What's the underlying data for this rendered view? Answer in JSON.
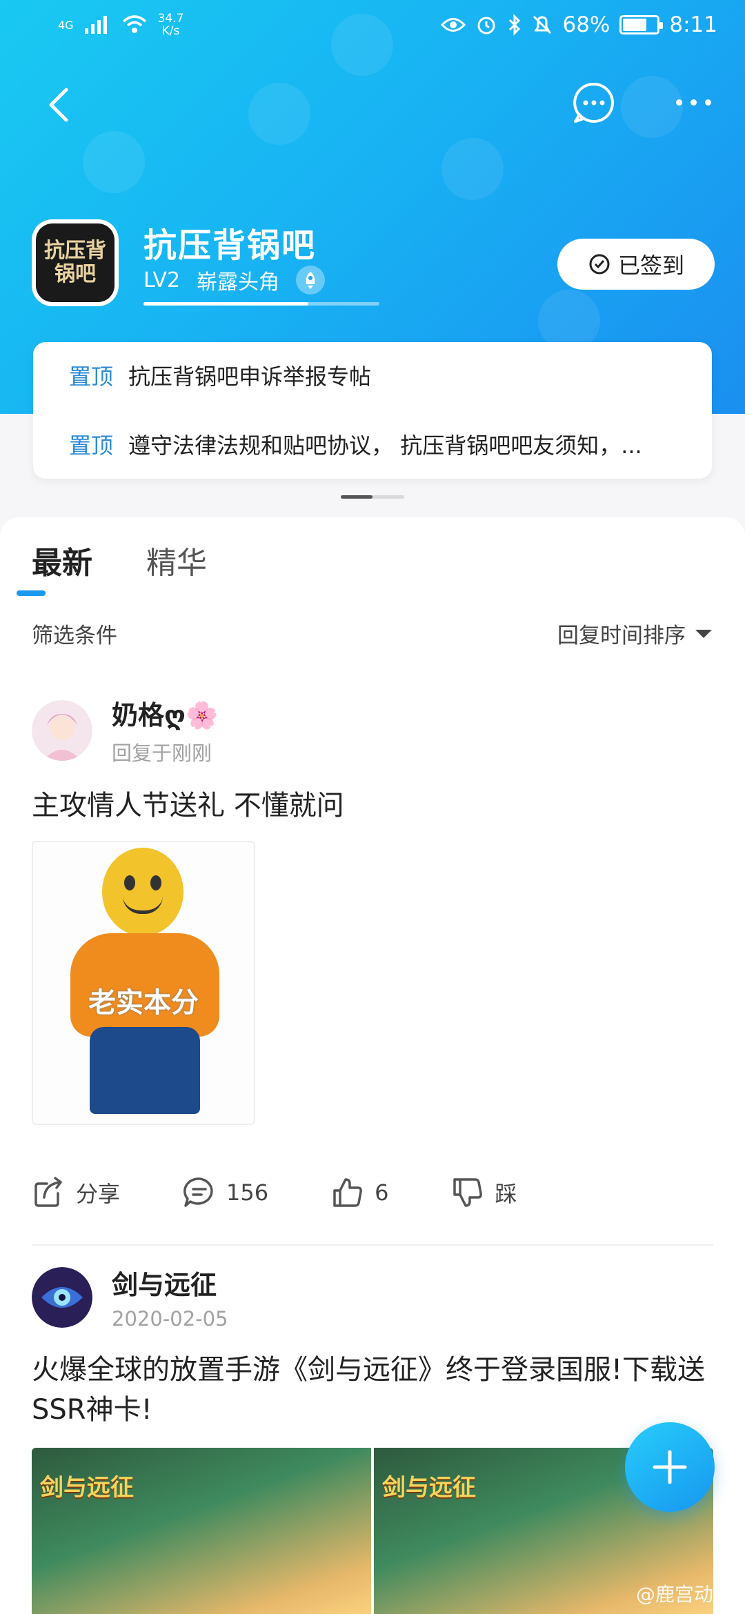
{
  "status_bar": {
    "network": "4G",
    "speed_value": "34.7",
    "speed_unit": "K/s",
    "battery_percent": "68%",
    "time": "8:11"
  },
  "forum": {
    "name": "抗压背锅吧",
    "avatar_text": "抗压背锅吧",
    "level": "LV2",
    "level_title": "崭露头角",
    "level_progress": 0.7,
    "signed_label": "已签到"
  },
  "pinned": [
    {
      "tag": "置顶",
      "text": "抗压背锅吧申诉举报专帖"
    },
    {
      "tag": "置顶",
      "text": "遵守法律法规和贴吧协议， 抗压背锅吧吧友须知，..."
    }
  ],
  "tabs": [
    {
      "label": "最新",
      "active": true
    },
    {
      "label": "精华",
      "active": false
    }
  ],
  "filter": {
    "label": "筛选条件",
    "sort_label": "回复时间排序"
  },
  "posts": [
    {
      "username": "奶格ღ🌸",
      "subtext": "回复于刚刚",
      "title": "主攻情人节送礼 不懂就问",
      "image_caption": "老实本分",
      "share_label": "分享",
      "comments": "156",
      "likes": "6",
      "dislike_label": "踩"
    },
    {
      "username": "剑与远征",
      "subtext": "2020-02-05",
      "title": "火爆全球的放置手游《剑与远征》终于登录国服!下载送SSR神卡!",
      "banner_logo": "剑与远征"
    }
  ],
  "watermark": "@鹿宫动漫",
  "colors": {
    "accent": "#1a9af0",
    "header_start": "#19c9f2",
    "header_end": "#1a8ff0",
    "pin_tag": "#2a8ad8"
  }
}
